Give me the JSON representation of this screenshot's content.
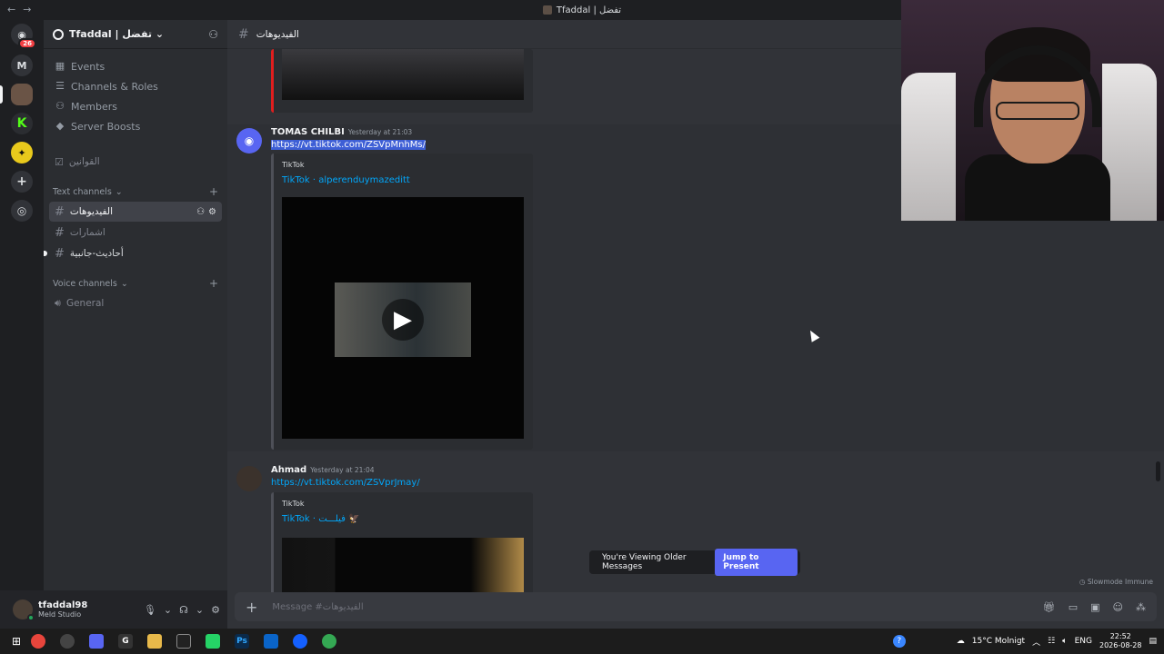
{
  "window": {
    "title": "Tfaddal | تفضل",
    "back": "←",
    "forward": "→"
  },
  "servers": {
    "dm_badge": "26",
    "letter_server": "M"
  },
  "guild": {
    "name": "Tfaddal | تفضل ⌄"
  },
  "menu": [
    {
      "label": "Events",
      "icon": "calendar-icon"
    },
    {
      "label": "Channels & Roles",
      "icon": "list-icon"
    },
    {
      "label": "Members",
      "icon": "members-icon"
    },
    {
      "label": "Server Boosts",
      "icon": "boost-icon"
    }
  ],
  "rules_channel": "القوانين",
  "text_category": "Text channels",
  "text_channels": [
    {
      "name": "الفيديوهات",
      "active": true
    },
    {
      "name": "اشمارات",
      "active": false
    },
    {
      "name": "أحاديث-جانبية",
      "active": false
    }
  ],
  "voice_category": "Voice channels",
  "voice_channels": [
    {
      "name": "General"
    }
  ],
  "user": {
    "name": "tfaddal98",
    "status": "Meld Studio"
  },
  "chat": {
    "channel": "الفيديوهات",
    "messages": [
      {
        "author": "TOMAS CHILBI",
        "timestamp": "Yesterday at 21:03",
        "link": "https://vt.tiktok.com/ZSVpMnhMs/",
        "embed_provider": "TikTok",
        "embed_title": "TikTok · alperenduymazeditt"
      },
      {
        "author": "Ahmad",
        "timestamp": "Yesterday at 21:04",
        "link": "https://vt.tiktok.com/ZSVprJmay/",
        "embed_provider": "TikTok",
        "embed_title": "TikTok · فيلـــت 🦅"
      }
    ],
    "older_notice": "You're Viewing Older Messages",
    "jump_button": "Jump to Present",
    "slowmode": "Slowmode Immune",
    "composer_placeholder": "Message #الفيديوهات"
  },
  "taskbar": {
    "weather": "15°C  Molnigt",
    "language": "ENG",
    "time": "22:52",
    "date": "2026-08-28"
  }
}
